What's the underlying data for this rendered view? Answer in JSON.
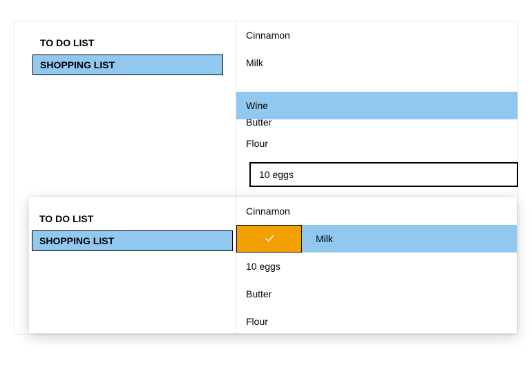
{
  "background": {
    "sidebar": {
      "items": [
        {
          "label": "TO DO LIST",
          "selected": false
        },
        {
          "label": "SHOPPING LIST",
          "selected": true
        }
      ]
    },
    "detail": {
      "items": [
        {
          "label": "Cinnamon"
        },
        {
          "label": "Milk"
        }
      ],
      "dragging_item": {
        "label": "Wine"
      },
      "below_items": [
        {
          "label": "Butter"
        },
        {
          "label": "Flour"
        }
      ]
    },
    "edit_value": "10 eggs"
  },
  "overlay": {
    "sidebar": {
      "items": [
        {
          "label": "TO DO LIST",
          "selected": false
        },
        {
          "label": "SHOPPING LIST",
          "selected": true
        }
      ]
    },
    "detail": {
      "items": [
        {
          "label": "Cinnamon",
          "selected": false
        },
        {
          "label": "Milk",
          "selected": true,
          "handle_icon": "check-icon"
        },
        {
          "label": "10 eggs",
          "selected": false
        },
        {
          "label": "Butter",
          "selected": false
        },
        {
          "label": "Flour",
          "selected": false
        }
      ]
    }
  }
}
